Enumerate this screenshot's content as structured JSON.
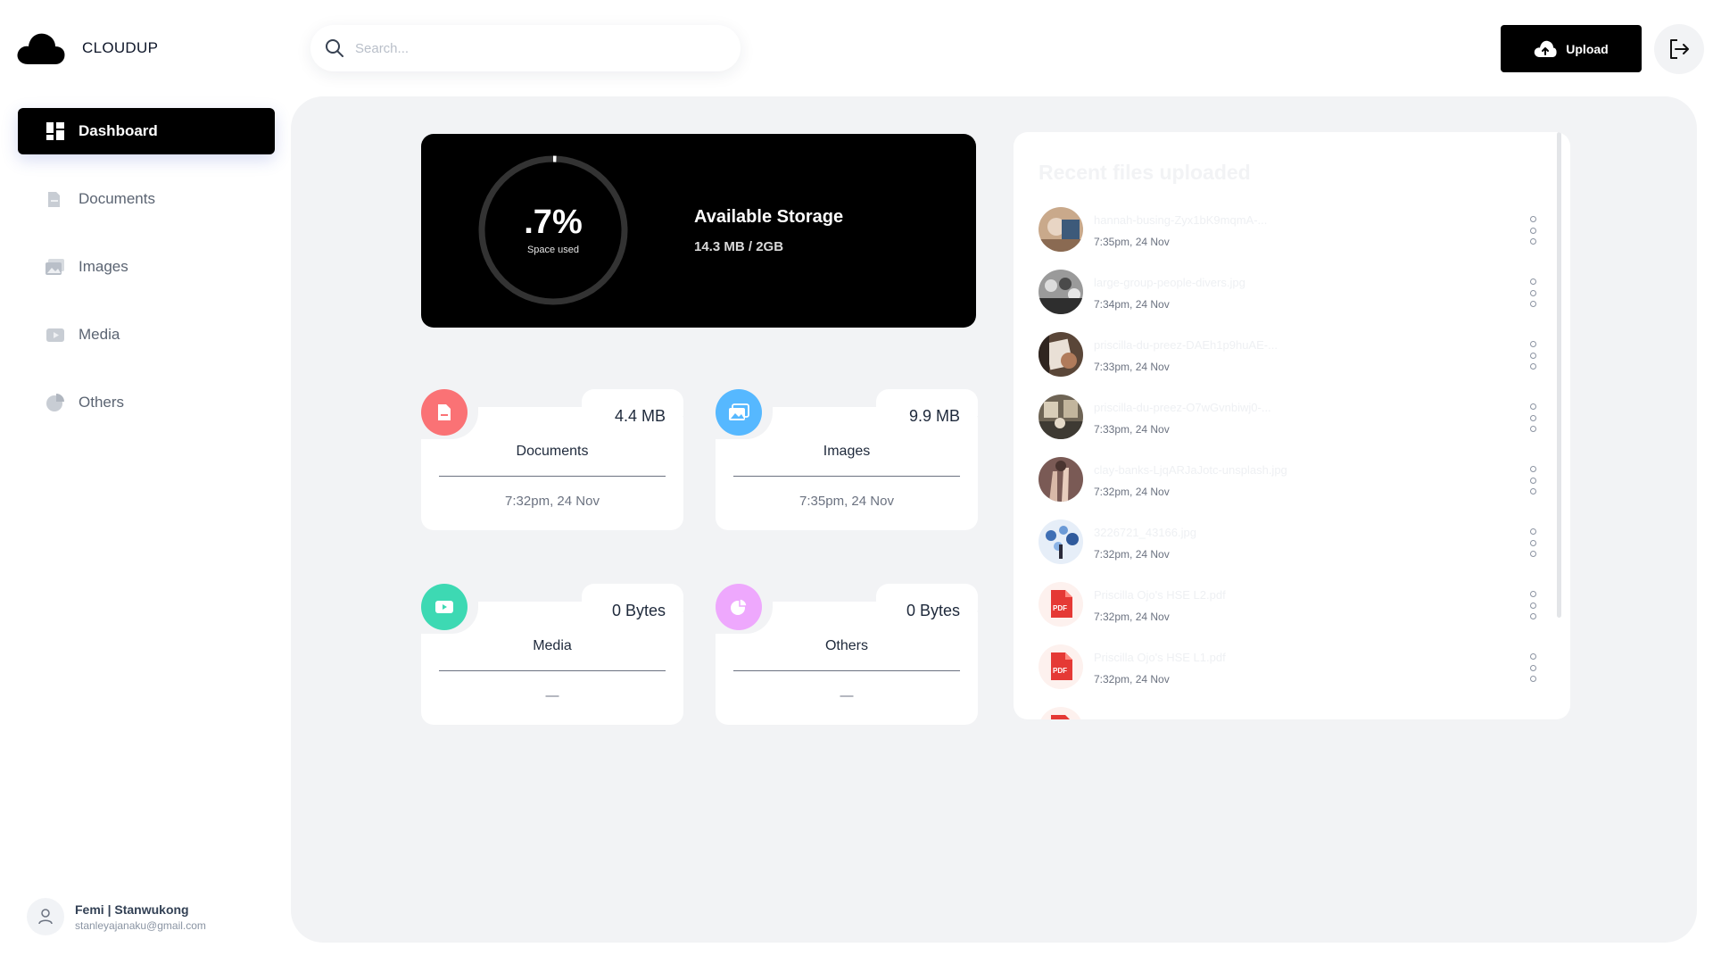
{
  "brand": {
    "name": "CLOUDUP"
  },
  "sidebar": {
    "items": [
      {
        "label": "Dashboard",
        "icon": "grid-icon"
      },
      {
        "label": "Documents",
        "icon": "document-icon"
      },
      {
        "label": "Images",
        "icon": "image-icon"
      },
      {
        "label": "Media",
        "icon": "video-icon"
      },
      {
        "label": "Others",
        "icon": "pie-icon"
      }
    ]
  },
  "user": {
    "name": "Femi | Stanwukong",
    "email": "stanleyajanaku@gmail.com"
  },
  "header": {
    "search_placeholder": "Search...",
    "upload_label": "Upload"
  },
  "storage": {
    "percent_label": ".7%",
    "percent_value": 0.7,
    "percent_sub": "Space used",
    "title": "Available Storage",
    "usage": "14.3 MB / 2GB"
  },
  "categories": [
    {
      "label": "Documents",
      "size": "4.4 MB",
      "time": "7:32pm, 24 Nov",
      "color": "#fa7275"
    },
    {
      "label": "Images",
      "size": "9.9 MB",
      "time": "7:35pm, 24 Nov",
      "color": "#56b8ff"
    },
    {
      "label": "Media",
      "size": "0 Bytes",
      "time": "—",
      "color": "#3dd9b3"
    },
    {
      "label": "Others",
      "size": "0 Bytes",
      "time": "—",
      "color": "#eea8fd"
    }
  ],
  "recent": {
    "title": "Recent files uploaded",
    "files": [
      {
        "name": "hannah-busing-Zyx1bK9mqmA-...",
        "time": "7:35pm, 24 Nov",
        "kind": "image"
      },
      {
        "name": "large-group-people-divers.jpg",
        "time": "7:34pm, 24 Nov",
        "kind": "image"
      },
      {
        "name": "priscilla-du-preez-DAEh1p9huAE-...",
        "time": "7:33pm, 24 Nov",
        "kind": "image"
      },
      {
        "name": "priscilla-du-preez-O7wGvnbiwj0-...",
        "time": "7:33pm, 24 Nov",
        "kind": "image"
      },
      {
        "name": "clay-banks-LjqARJaJotc-unsplash.jpg",
        "time": "7:32pm, 24 Nov",
        "kind": "image"
      },
      {
        "name": "3226721_43166.jpg",
        "time": "7:32pm, 24 Nov",
        "kind": "image"
      },
      {
        "name": "Priscilla Ojo's HSE L2.pdf",
        "time": "7:32pm, 24 Nov",
        "kind": "pdf"
      },
      {
        "name": "Priscilla Ojo's HSE L1.pdf",
        "time": "7:32pm, 24 Nov",
        "kind": "pdf"
      }
    ]
  }
}
